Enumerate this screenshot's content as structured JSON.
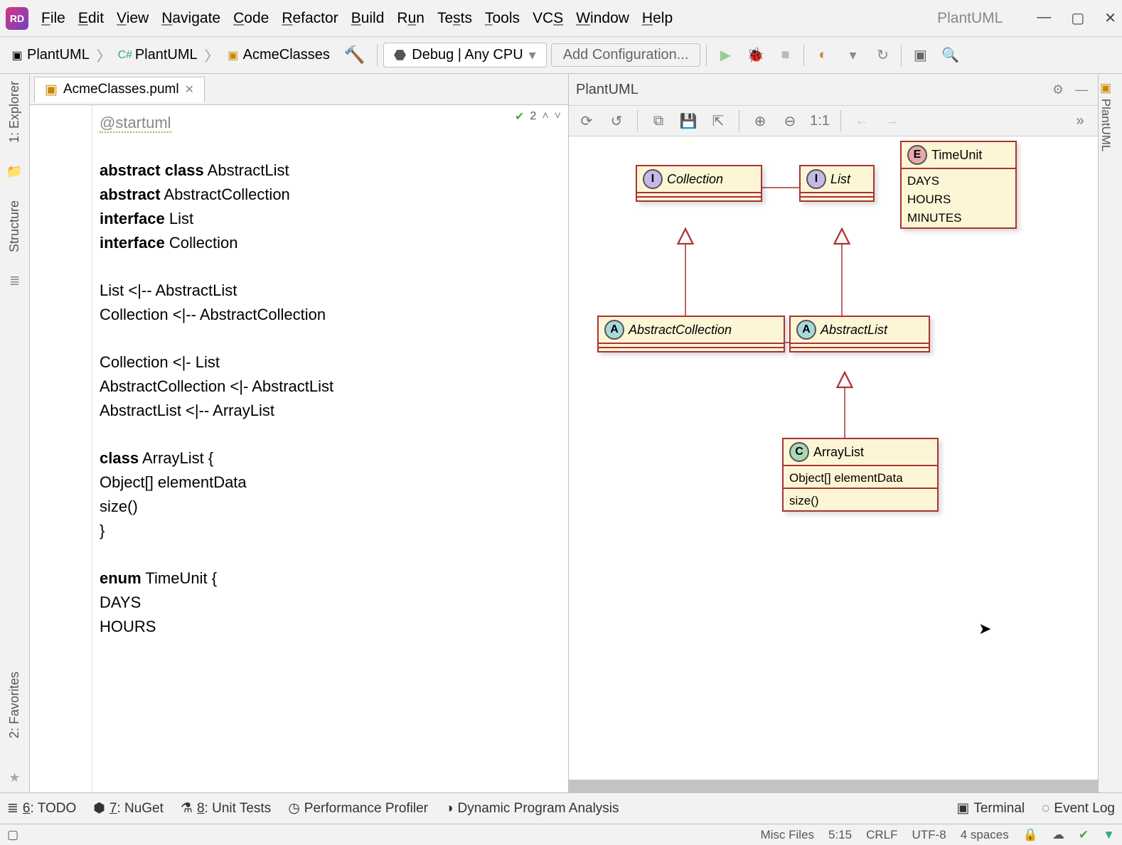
{
  "app": {
    "title": "PlantUML",
    "logo": "RD"
  },
  "menu": {
    "file": "File",
    "edit": "Edit",
    "view": "View",
    "navigate": "Navigate",
    "code": "Code",
    "refactor": "Refactor",
    "build": "Build",
    "run": "Run",
    "tests": "Tests",
    "tools": "Tools",
    "vcs": "VCS",
    "window": "Window",
    "help": "Help"
  },
  "breadcrumb": {
    "a": "PlantUML",
    "b": "PlantUML",
    "c": "AcmeClasses"
  },
  "debug": {
    "label": "Debug | Any CPU"
  },
  "config": {
    "label": "Add Configuration..."
  },
  "tab": {
    "name": "AcmeClasses.puml"
  },
  "inspect": {
    "count": "2"
  },
  "left": {
    "explorer": "1: Explorer",
    "structure": "Structure",
    "favorites": "2: Favorites"
  },
  "right": {
    "plantuml": "PlantUML"
  },
  "panel": {
    "title": "PlantUML",
    "zoom": "1:1"
  },
  "code": {
    "l1": "@startuml",
    "l2a": "abstract class",
    "l2b": " AbstractList",
    "l3a": "abstract",
    "l3b": " AbstractCollection",
    "l4a": "interface",
    "l4b": " List",
    "l5a": "interface",
    "l5b": " Collection",
    "l6": "List <|-- AbstractList",
    "l7": "Collection <|-- AbstractCollection",
    "l8": "Collection <|- List",
    "l9": "AbstractCollection <|- AbstractList",
    "l10": "AbstractList <|-- ArrayList",
    "l11a": "class",
    "l11b": " ArrayList {",
    "l12": "Object[] elementData",
    "l13": "size()",
    "l14": "}",
    "l15a": "enum",
    "l15b": " TimeUnit {",
    "l16": "DAYS",
    "l17": "HOURS"
  },
  "uml": {
    "collection": "Collection",
    "list": "List",
    "abscoll": "AbstractCollection",
    "abslist": "AbstractList",
    "arraylist": "ArrayList",
    "al_m1": "Object[] elementData",
    "al_m2": "size()",
    "timeunit": "TimeUnit",
    "tu1": "DAYS",
    "tu2": "HOURS",
    "tu3": "MINUTES"
  },
  "bottom": {
    "todo": "6: TODO",
    "nuget": "7: NuGet",
    "unittests": "8: Unit Tests",
    "perf": "Performance Profiler",
    "dpa": "Dynamic Program Analysis",
    "terminal": "Terminal",
    "eventlog": "Event Log"
  },
  "status": {
    "misc": "Misc Files",
    "pos": "5:15",
    "le": "CRLF",
    "enc": "UTF-8",
    "indent": "4 spaces"
  }
}
